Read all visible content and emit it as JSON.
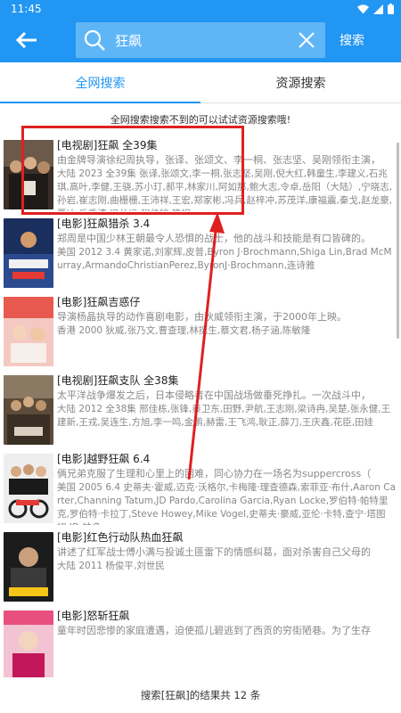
{
  "status": {
    "time": "11:45"
  },
  "search": {
    "query": "狂飙",
    "submit_label": "搜索"
  },
  "tabs": [
    {
      "label": "全网搜索"
    },
    {
      "label": "资源搜索"
    }
  ],
  "hint": "全网搜索搜索不到的可以试试资源搜索哦!",
  "results": [
    {
      "title": "[电视剧]狂飙 全39集",
      "desc": "由金牌导演徐纪周执导，张译、张颂文、李一桐、张志坚、吴刚领衔主演，",
      "meta": "大陆 2023 全39集 张译,张颂文,李一桐,张志坚,吴刚,倪大红,韩童生,李建义,石兆琪,高叶,李健,王骁,苏小玎,郝平,林家川,阿如那,鲍大志,令卓,岳阳（大陆）,宁晓志,孙岩,崔志刚,曲栅栅,王沛祥,王宏,郑家彬,冯兵,赵梓冲,苏茂洋,康福震,秦戈,赵龙豪,贾冰,岳秀清,冯丛运,程佳铭,隆妮"
    },
    {
      "title": "[电影]狂飙猎杀 3.4",
      "desc": "郑周是中国少林王朝最令人恐惧的战士，他的战斗和技能是有口皆碑的。",
      "meta": "美国 2012 3.4 黄家诺,刘家辉,皮普,Byron J·Brochmann,Shiga Lin,Brad McMurray,ArmandoChristianPerez,ByronJ·Brochmann,连诗雅"
    },
    {
      "title": "[电影]狂飙吉惑仔",
      "desc": "导演杨晶执导的动作喜剧电影，由狄威领衔主演，于2000年上映。",
      "meta": "香港 2000 狄威,张乃文,曹查理,林挺生,蔡文君,杨子涵,陈敏隆"
    },
    {
      "title": "[电视剧]狂飙支队 全38集",
      "desc": "太平洋战争爆发之后，日本侵略者在中国战场做垂死挣扎。一次战斗中，",
      "meta": "大陆 2012 全38集 邢佳栋,张锋,秦卫东,田野,尹航,王志刚,梁诗冉,吴楚,张永健,王建新,王戎,吴连生,方旭,李一鸣,金鹏,赫雷,王飞鸿,耿正,薛刀,王庆鑫,花臣,田娃"
    },
    {
      "title": "[电影]越野狂飙 6.4",
      "desc": "俩兄弟克服了生理和心里上的困难，同心协力在一场名为suppercross（",
      "meta": "美国 2005 6.4 史蒂夫·霍威,迈克·沃格尔,卡梅隆·理查德森,索菲亚·布什,Aaron Carter,Channing Tatum,JD Pardo,Carolina Garcia,Ryan Locke,罗伯特·帕特里克,罗伯特·卡拉丁,Steve Howey,Mike Vogel,史蒂夫·豪威,亚伦·卡特,查宁·塔图姆,JD·帕多"
    },
    {
      "title": "[电影]红色行动队热血狂飙",
      "desc": "讲述了红军战士傅小满与投诚土匪雷下的情感纠葛，面对杀害自己父母的",
      "meta": "大陆 2011 杨俊平,刘世民"
    },
    {
      "title": "[电影]怒斩狂飙",
      "desc": "童年时因悲惨的家庭遭遇，迫使孤儿碧逃到了西贡的穷街陋巷。为了生存",
      "meta": ""
    }
  ],
  "footer": "搜索[狂飙]的结果共 12 条",
  "colors": {
    "primary": "#2196f3",
    "annotation": "#e02020"
  }
}
